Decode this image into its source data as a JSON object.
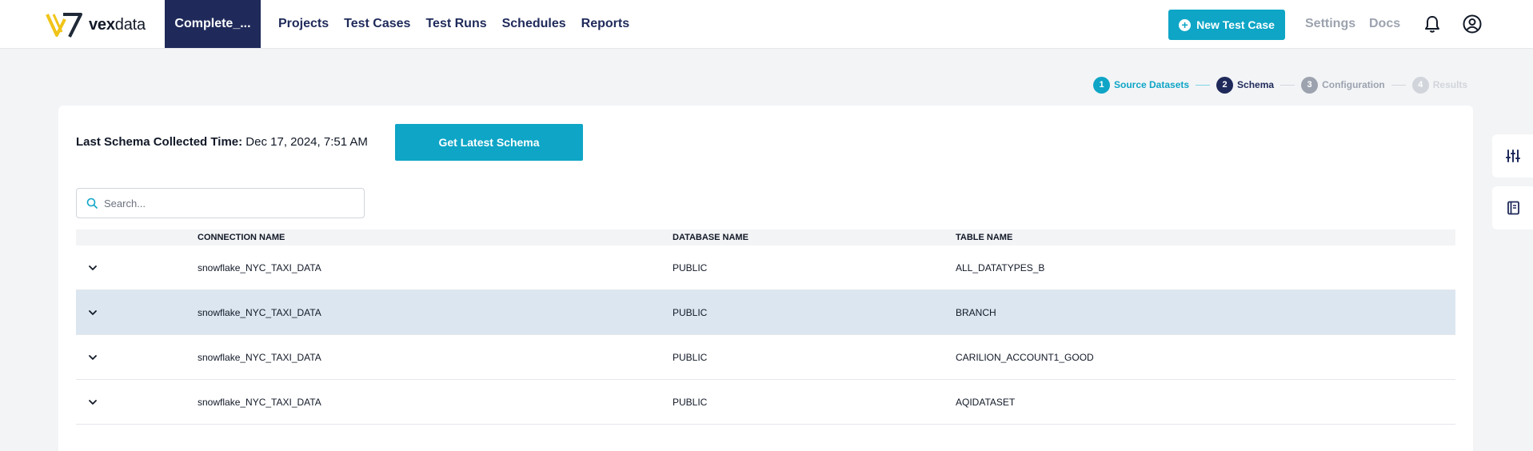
{
  "brand": {
    "name_bold": "vex",
    "name_rest": "data"
  },
  "project": {
    "label": "Complete_..."
  },
  "nav": {
    "items": [
      {
        "label": "Projects"
      },
      {
        "label": "Test Cases"
      },
      {
        "label": "Test Runs"
      },
      {
        "label": "Schedules"
      },
      {
        "label": "Reports"
      }
    ]
  },
  "header_actions": {
    "new_test_case": "New Test Case",
    "settings": "Settings",
    "docs": "Docs"
  },
  "stepper": {
    "steps": [
      {
        "num": "1",
        "label": "Source Datasets",
        "state": "done"
      },
      {
        "num": "2",
        "label": "Schema",
        "state": "active"
      },
      {
        "num": "3",
        "label": "Configuration",
        "state": "pending"
      },
      {
        "num": "4",
        "label": "Results",
        "state": "disabled"
      }
    ]
  },
  "schema": {
    "collected_label": "Last Schema Collected Time:",
    "collected_value": "Dec 17, 2024, 7:51 AM",
    "get_latest_button": "Get Latest Schema"
  },
  "search": {
    "placeholder": "Search..."
  },
  "table": {
    "columns": [
      "CONNECTION NAME",
      "DATABASE NAME",
      "TABLE NAME"
    ],
    "rows": [
      {
        "connection": "snowflake_NYC_TAXI_DATA",
        "database": "PUBLIC",
        "table": "ALL_DATATYPES_B",
        "highlighted": false
      },
      {
        "connection": "snowflake_NYC_TAXI_DATA",
        "database": "PUBLIC",
        "table": "BRANCH",
        "highlighted": true
      },
      {
        "connection": "snowflake_NYC_TAXI_DATA",
        "database": "PUBLIC",
        "table": "CARILION_ACCOUNT1_GOOD",
        "highlighted": false
      },
      {
        "connection": "snowflake_NYC_TAXI_DATA",
        "database": "PUBLIC",
        "table": "AQIDATASET",
        "highlighted": false
      }
    ]
  },
  "side_tools": [
    {
      "icon": "sliders-icon"
    },
    {
      "icon": "notebook-icon"
    }
  ],
  "colors": {
    "brand_navy": "#1f2a5a",
    "accent_teal": "#0ea5c6",
    "row_highlight": "#dbe6f0"
  }
}
